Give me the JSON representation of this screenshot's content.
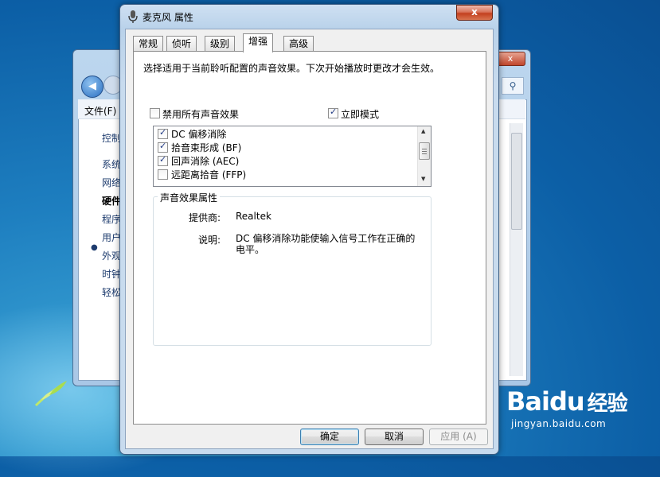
{
  "background_window": {
    "menu_file": "文件(F)",
    "sidebar": [
      "控制",
      "系统",
      "网络",
      "硬件",
      "程序",
      "用户",
      "外观",
      "时钟",
      "轻松"
    ],
    "active_index": 3
  },
  "dialog": {
    "title": "麦克风 属性",
    "close_label": "x",
    "tabs": [
      "常规",
      "侦听",
      "级别",
      "增强",
      "高级"
    ],
    "active_tab": "增强",
    "description": "选择适用于当前聆听配置的声音效果。下次开始播放时更改才会生效。",
    "disable_all": {
      "label": "禁用所有声音效果",
      "checked": false
    },
    "immediate_mode": {
      "label": "立即模式",
      "checked": true
    },
    "effects": [
      {
        "label": "DC 偏移消除",
        "checked": true
      },
      {
        "label": "拾音束形成 (BF)",
        "checked": true
      },
      {
        "label": "回声消除 (AEC)",
        "checked": true
      },
      {
        "label": "远距离拾音 (FFP)",
        "checked": false
      }
    ],
    "properties_group": {
      "legend": "声音效果属性",
      "provider_label": "提供商:",
      "provider_value": "Realtek",
      "description_label": "说明:",
      "description_value": "DC 偏移消除功能使输入信号工作在正确的电平。"
    },
    "buttons": {
      "ok": "确定",
      "cancel": "取消",
      "apply": "应用 (A)"
    }
  },
  "watermark": {
    "logo": "Bai",
    "logo2": "du",
    "suffix": "经验",
    "url": "jingyan.baidu.com"
  },
  "colors": {
    "arrow": "#b00c0c",
    "desktop": "#1e7fc0"
  }
}
